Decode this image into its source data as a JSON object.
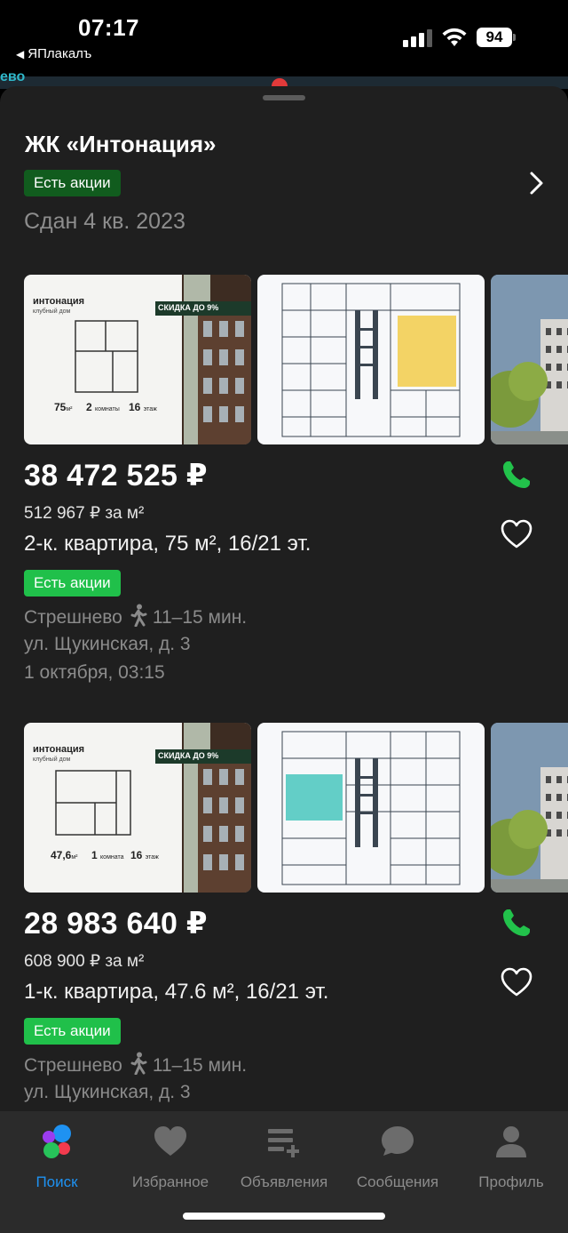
{
  "status_bar": {
    "time": "07:17",
    "back_app": "ЯПлакалъ",
    "battery": "94"
  },
  "map": {
    "label": "ево"
  },
  "complex": {
    "title": "ЖК «Интонация»",
    "badge": "Есть акции",
    "status": "Сдан 4 кв. 2023"
  },
  "listings": [
    {
      "promo": {
        "brand": "интонация",
        "sub": "клубный дом",
        "discount": "СКИДКА ДО 9%",
        "area": "75",
        "area_unit": "м²",
        "rooms": "2",
        "rooms_label": "комнаты",
        "floor": "16",
        "floor_label": "этаж"
      },
      "price": "38 472 525 ₽",
      "price_per_m2": "512 967 ₽ за м²",
      "description": "2-к. квартира, 75 м², 16/21 эт.",
      "badge": "Есть акции",
      "metro": "Стрешнево",
      "walk_time": "11–15 мин.",
      "address": "ул. Щукинская, д. 3",
      "date": "1 октября, 03:15",
      "highlight_color": "#f2cd4a"
    },
    {
      "promo": {
        "brand": "интонация",
        "sub": "клубный дом",
        "discount": "СКИДКА ДО 9%",
        "area": "47,6",
        "area_unit": "м²",
        "rooms": "1",
        "rooms_label": "комната",
        "floor": "16",
        "floor_label": "этаж"
      },
      "price": "28 983 640 ₽",
      "price_per_m2": "608 900 ₽ за м²",
      "description": "1-к. квартира, 47.6 м², 16/21 эт.",
      "badge": "Есть акции",
      "metro": "Стрешнево",
      "walk_time": "11–15 мин.",
      "address": "ул. Щукинская, д. 3",
      "highlight_color": "#49c7bd"
    }
  ],
  "tabs": [
    {
      "label": "Поиск",
      "icon": "search-dots-icon",
      "active": true
    },
    {
      "label": "Избранное",
      "icon": "heart-icon",
      "active": false
    },
    {
      "label": "Объявления",
      "icon": "add-listing-icon",
      "active": false
    },
    {
      "label": "Сообщения",
      "icon": "chat-bubble-icon",
      "active": false
    },
    {
      "label": "Профиль",
      "icon": "profile-icon",
      "active": false
    }
  ],
  "colors": {
    "accent": "#1e92f2",
    "deal_green": "#20c04a",
    "dark_green": "#115c1e",
    "sheet_bg": "#1f1f1f"
  }
}
